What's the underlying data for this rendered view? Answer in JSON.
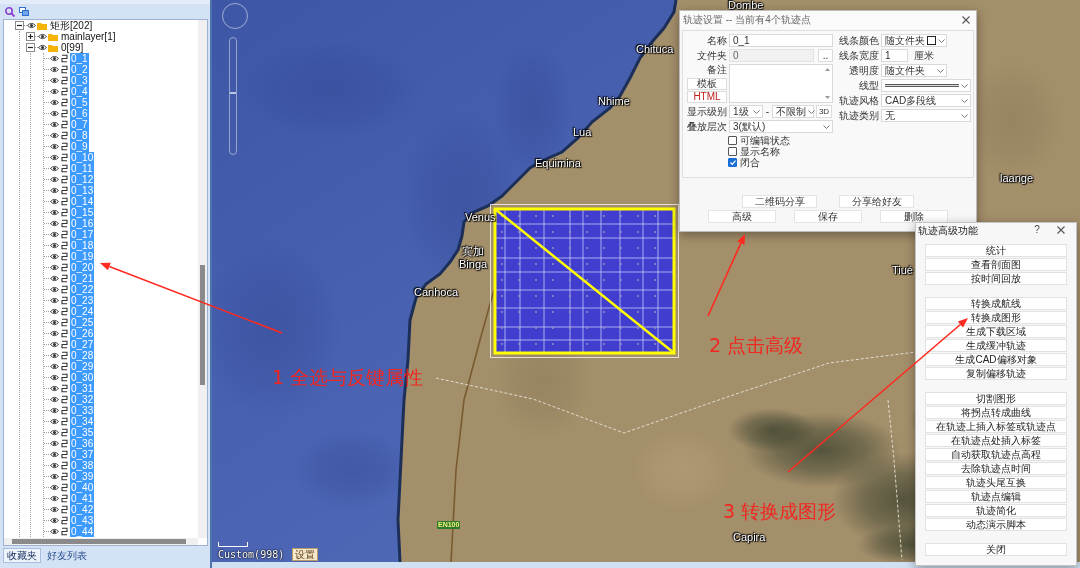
{
  "left_panel": {
    "tree": [
      {
        "label": "矩形[202]",
        "expanded": true,
        "selected": false,
        "children": [
          {
            "label": "mainlayer[1]",
            "expanded": false,
            "selected": false
          },
          {
            "label": "0[99]",
            "expanded": true,
            "selected": false,
            "children": [
              {
                "label": "0_1",
                "selected": true
              },
              {
                "label": "0_2",
                "selected": true
              },
              {
                "label": "0_3",
                "selected": true
              },
              {
                "label": "0_4",
                "selected": true
              },
              {
                "label": "0_5",
                "selected": true
              },
              {
                "label": "0_6",
                "selected": true
              },
              {
                "label": "0_7",
                "selected": true
              },
              {
                "label": "0_8",
                "selected": true
              },
              {
                "label": "0_9",
                "selected": true
              },
              {
                "label": "0_10",
                "selected": true
              },
              {
                "label": "0_11",
                "selected": true
              },
              {
                "label": "0_12",
                "selected": true
              },
              {
                "label": "0_13",
                "selected": true
              },
              {
                "label": "0_14",
                "selected": true
              },
              {
                "label": "0_15",
                "selected": true
              },
              {
                "label": "0_16",
                "selected": true
              },
              {
                "label": "0_17",
                "selected": true
              },
              {
                "label": "0_18",
                "selected": true
              },
              {
                "label": "0_19",
                "selected": true
              },
              {
                "label": "0_20",
                "selected": true
              },
              {
                "label": "0_21",
                "selected": true
              },
              {
                "label": "0_22",
                "selected": true
              },
              {
                "label": "0_23",
                "selected": true
              },
              {
                "label": "0_24",
                "selected": true
              },
              {
                "label": "0_25",
                "selected": true
              },
              {
                "label": "0_26",
                "selected": true
              },
              {
                "label": "0_27",
                "selected": true
              },
              {
                "label": "0_28",
                "selected": true
              },
              {
                "label": "0_29",
                "selected": true
              },
              {
                "label": "0_30",
                "selected": true
              },
              {
                "label": "0_31",
                "selected": true
              },
              {
                "label": "0_32",
                "selected": true
              },
              {
                "label": "0_33",
                "selected": true
              },
              {
                "label": "0_34",
                "selected": true
              },
              {
                "label": "0_35",
                "selected": true
              },
              {
                "label": "0_36",
                "selected": true
              },
              {
                "label": "0_37",
                "selected": true
              },
              {
                "label": "0_38",
                "selected": true
              },
              {
                "label": "0_39",
                "selected": true
              },
              {
                "label": "0_40",
                "selected": true
              },
              {
                "label": "0_41",
                "selected": true
              },
              {
                "label": "0_42",
                "selected": true
              },
              {
                "label": "0_43",
                "selected": true
              },
              {
                "label": "0_44",
                "selected": true
              }
            ]
          }
        ]
      }
    ],
    "tabs": [
      {
        "label": "收藏夹",
        "selected": true
      },
      {
        "label": "好友列表",
        "selected": false
      }
    ]
  },
  "map": {
    "labels": [
      {
        "text": "Dombe",
        "kind": "place"
      },
      {
        "text": "Chituca",
        "kind": "place"
      },
      {
        "text": "Nhime",
        "kind": "place"
      },
      {
        "text": "Lua",
        "kind": "place"
      },
      {
        "text": "Equimina",
        "kind": "place"
      },
      {
        "text": "laange",
        "kind": "place"
      },
      {
        "text": "Venus",
        "kind": "place"
      },
      {
        "text": "宾加",
        "kind": "place"
      },
      {
        "text": "Binga",
        "kind": "place"
      },
      {
        "text": "Tiué",
        "kind": "place"
      },
      {
        "text": "Canhoca",
        "kind": "place"
      },
      {
        "text": "EN100",
        "kind": "road"
      },
      {
        "text": "Capira",
        "kind": "place"
      }
    ],
    "zoom_slider": {
      "level": 0.53
    },
    "projection": "Custom(998)",
    "settings_button": "设置"
  },
  "track_dialog": {
    "title": "轨迹设置 -- 当前有4个轨迹点",
    "name": {
      "label": "名称",
      "value": "0_1"
    },
    "folder": {
      "label": "文件夹",
      "value": "0",
      "browse_button": ".."
    },
    "note": {
      "label": "备注"
    },
    "template_button": "模板",
    "html_button": "HTML",
    "display_level": {
      "label": "显示级别",
      "min": "1级",
      "separator": "-",
      "max": "不限制",
      "button": "3D"
    },
    "stack_order": {
      "label": "叠放层次",
      "value": "3(默认)"
    },
    "checkboxes": [
      {
        "label": "可编辑状态",
        "checked": false
      },
      {
        "label": "显示名称",
        "checked": false
      },
      {
        "label": "闭合",
        "checked": true
      }
    ],
    "line_color": {
      "label": "线条颜色",
      "value": "随文件夹"
    },
    "line_width": {
      "label": "线条宽度",
      "value": "1",
      "unit": "厘米"
    },
    "opacity": {
      "label": "透明度",
      "value": "随文件夹"
    },
    "line_type": {
      "label": "线型"
    },
    "track_style": {
      "label": "轨迹风格",
      "value": "CAD多段线"
    },
    "track_category": {
      "label": "轨迹类别",
      "value": "无"
    },
    "share_buttons": [
      "二维码分享",
      "分享给好友"
    ],
    "action_buttons": [
      "高级",
      "保存",
      "删除"
    ]
  },
  "advanced_panel": {
    "title": "轨迹高级功能",
    "help": "?",
    "button_groups": [
      [
        "统计",
        "查看剖面图",
        "按时间回放"
      ],
      [
        "转换成航线",
        "转换成图形",
        "生成下载区域",
        "生成缓冲轨迹",
        "生成CAD偏移对象",
        "复制偏移轨迹"
      ],
      [
        "切割图形",
        "将拐点转成曲线",
        "在轨迹上插入标签或轨迹点",
        "在轨迹点处插入标签",
        "自动获取轨迹点高程",
        "去除轨迹点时间",
        "轨迹头尾互换",
        "轨迹点编辑",
        "轨迹简化",
        "动态演示脚本"
      ],
      [
        "关闭"
      ]
    ]
  },
  "annotations": [
    "1 全选与反键属性",
    "2 点击高级",
    "3 转换成图形"
  ]
}
